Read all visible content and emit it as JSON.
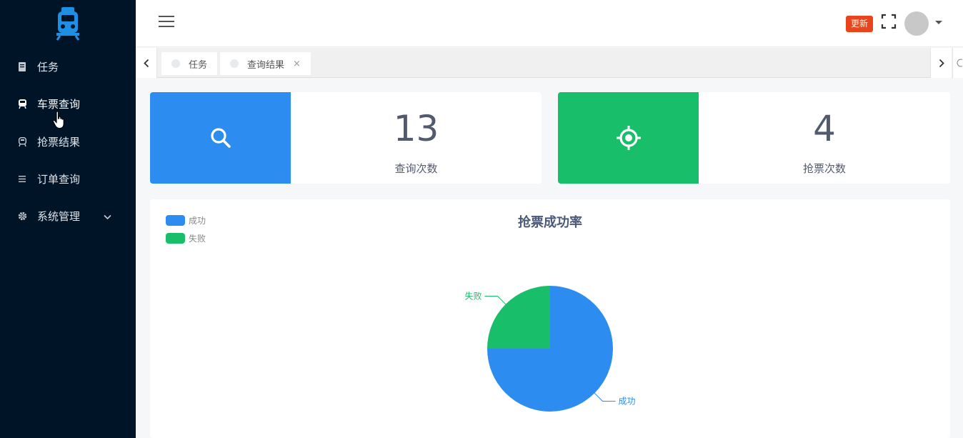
{
  "sidebar": {
    "items": [
      {
        "label": "任务",
        "icon": "document-icon"
      },
      {
        "label": "车票查询",
        "icon": "train-icon"
      },
      {
        "label": "抢票结果",
        "icon": "train-outline-icon"
      },
      {
        "label": "订单查询",
        "icon": "list-icon"
      },
      {
        "label": "系统管理",
        "icon": "gear-icon"
      }
    ]
  },
  "header": {
    "update_label": "更新"
  },
  "tabs": [
    {
      "label": "任务"
    },
    {
      "label": "查询结果",
      "close": "×"
    }
  ],
  "stats": [
    {
      "value": "13",
      "label": "查询次数",
      "color": "#2d8cf0",
      "icon": "search-icon"
    },
    {
      "value": "4",
      "label": "抢票次数",
      "color": "#19be6b",
      "icon": "target-icon"
    }
  ],
  "chart_data": {
    "type": "pie",
    "title": "抢票成功率",
    "legend": [
      "成功",
      "失败"
    ],
    "legend_position": "top-left",
    "series": [
      {
        "name": "成功",
        "value": 75,
        "color": "#2d8cf0"
      },
      {
        "name": "失败",
        "value": 25,
        "color": "#19be6b"
      }
    ]
  }
}
